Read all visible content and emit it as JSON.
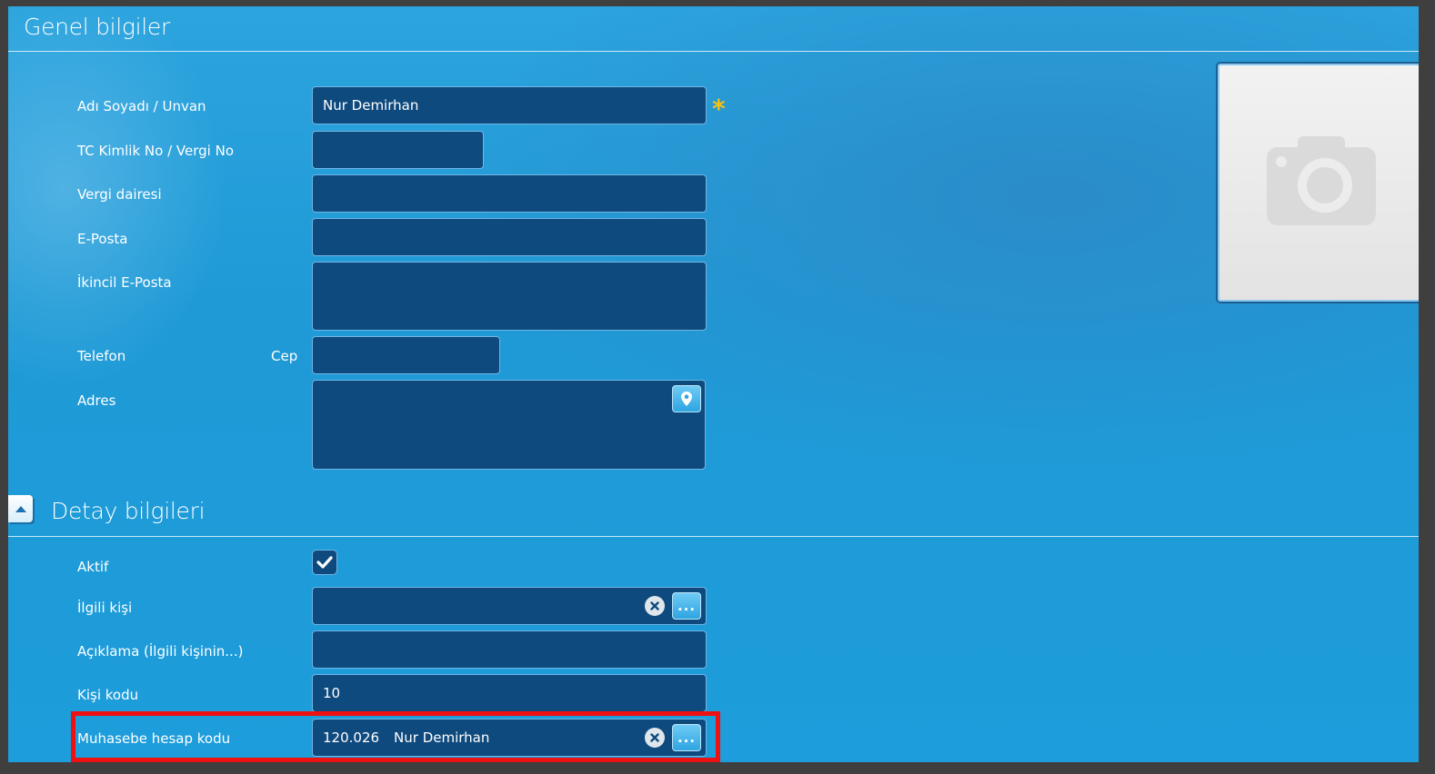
{
  "general": {
    "title": "Genel bilgiler",
    "labels": {
      "name": "Adı Soyadı / Unvan",
      "tc": "TC Kimlik No / Vergi No",
      "tax_office": "Vergi dairesi",
      "email": "E-Posta",
      "email2": "İkincil E-Posta",
      "phone": "Telefon",
      "mobile": "Cep",
      "address": "Adres"
    },
    "values": {
      "name": "Nur Demirhan",
      "tc": "",
      "tax_office": "",
      "email": "",
      "email2": "",
      "mobile": "",
      "address": ""
    },
    "required_mark": "*"
  },
  "detail": {
    "title": "Detay bilgileri",
    "labels": {
      "active": "Aktif",
      "contact": "İlgili kişi",
      "description": "Açıklama (İlgili kişinin...)",
      "person_code": "Kişi kodu",
      "account_code": "Muhasebe hesap kodu"
    },
    "values": {
      "active": true,
      "contact": "",
      "description": "",
      "person_code": "10",
      "account_code": "120.026",
      "account_name": "Nur Demirhan"
    },
    "dots_label": "..."
  },
  "colors": {
    "background": "#1f9ad6",
    "field": "#0f4a7e",
    "required": "#f5c211",
    "highlight": "#ee1111"
  },
  "icons": {
    "photo": "camera-icon",
    "map": "map-pin-icon",
    "clear": "clear-x-icon",
    "collapse": "chevron-up-icon",
    "check": "checkmark-icon"
  }
}
